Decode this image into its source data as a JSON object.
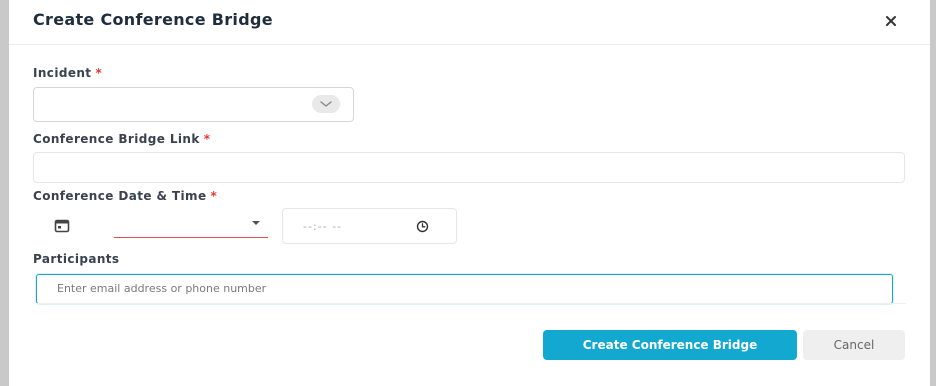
{
  "modal": {
    "title": "Create Conference Bridge"
  },
  "form": {
    "incident": {
      "label": "Incident",
      "required_mark": "*",
      "value": ""
    },
    "bridge_link": {
      "label": "Conference Bridge Link",
      "required_mark": "*",
      "value": ""
    },
    "datetime": {
      "label": "Conference Date & Time",
      "required_mark": "*",
      "date_value": "",
      "time_placeholder": "--:-- --"
    },
    "participants": {
      "label": "Participants",
      "placeholder": "Enter email address or phone number"
    }
  },
  "actions": {
    "primary_label": "Create Conference Bridge",
    "secondary_label": "Cancel"
  },
  "colors": {
    "accent": "#13a8cf",
    "required": "#e53935",
    "error_underline": "#d9534f"
  },
  "icons": {
    "close": "close-icon",
    "select": "chevron-down-icon",
    "date": "calendar-icon",
    "time": "clock-icon"
  }
}
